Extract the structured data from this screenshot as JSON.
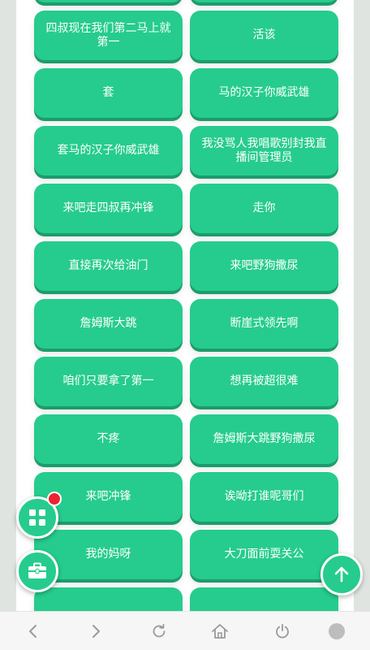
{
  "buttons": [
    {
      "label": ""
    },
    {
      "label": ""
    },
    {
      "label": "四叔现在我们第二马上就第一"
    },
    {
      "label": "活该"
    },
    {
      "label": "套"
    },
    {
      "label": "马的汉子你威武雄"
    },
    {
      "label": "套马的汉子你威武雄"
    },
    {
      "label": "我没骂人我唱歌别封我直播间管理员"
    },
    {
      "label": "来吧走四叔再冲锋"
    },
    {
      "label": "走你"
    },
    {
      "label": "直接再次给油门"
    },
    {
      "label": "来吧野狗撒尿"
    },
    {
      "label": "詹姆斯大跳"
    },
    {
      "label": "断崖式领先啊"
    },
    {
      "label": "咱们只要拿了第一"
    },
    {
      "label": "想再被超很难"
    },
    {
      "label": "不疼"
    },
    {
      "label": "詹姆斯大跳野狗撒尿"
    },
    {
      "label": "来吧冲锋"
    },
    {
      "label": "诶呦打谁呢哥们"
    },
    {
      "label": "我的妈呀"
    },
    {
      "label": "大刀面前耍关公"
    },
    {
      "label": ""
    },
    {
      "label": ""
    }
  ],
  "colors": {
    "accent": "#26cc8d",
    "badge": "#ee2233"
  },
  "icons": {
    "apps": "grid-icon",
    "tools": "toolbox-icon",
    "top": "arrow-up-icon"
  },
  "navbar": [
    "back-icon",
    "forward-icon",
    "refresh-icon",
    "home-icon",
    "power-icon",
    "circle-icon"
  ]
}
